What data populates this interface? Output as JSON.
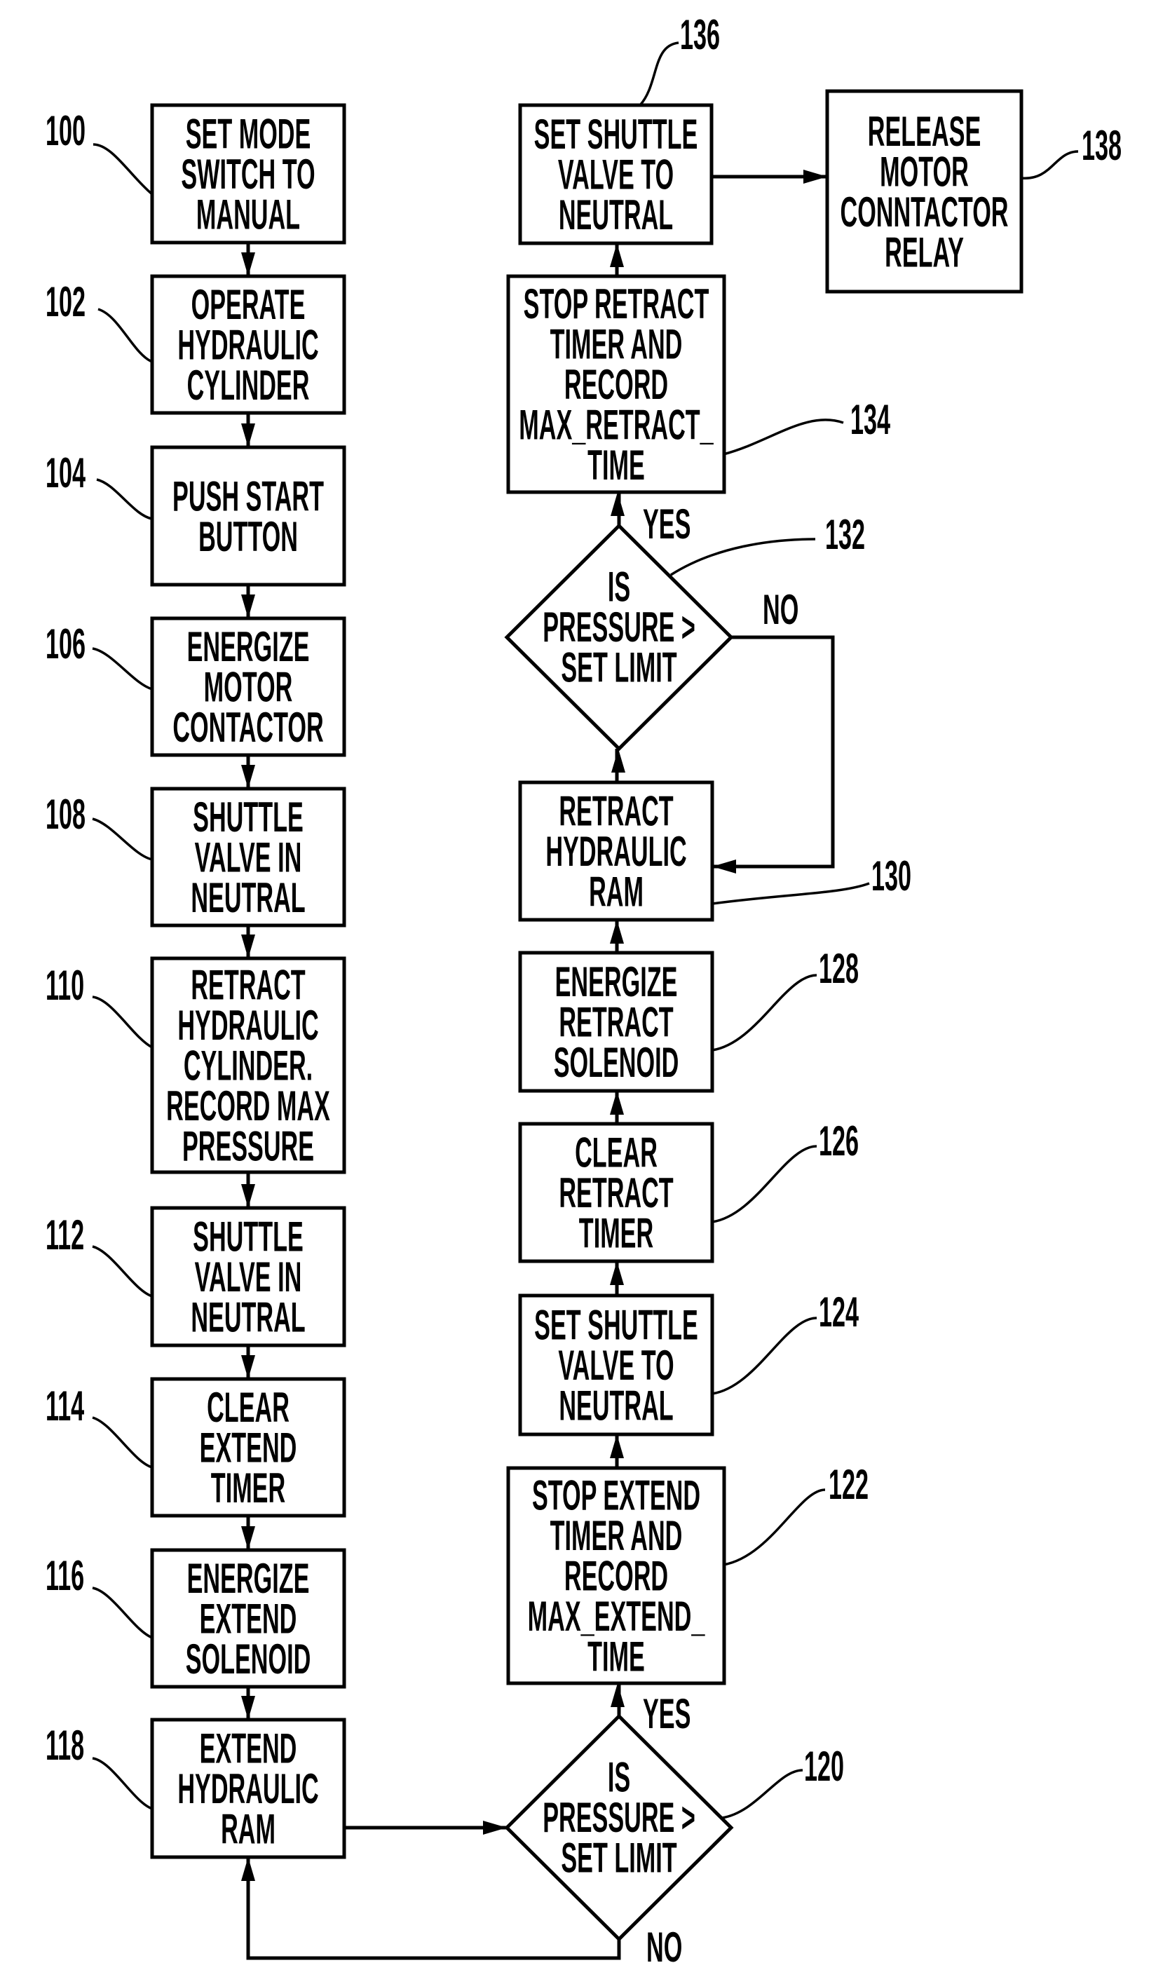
{
  "figure": {
    "steps": [
      {
        "id": "100",
        "shape": "process",
        "lines": [
          "SET MODE",
          "SWITCH TO",
          "MANUAL"
        ]
      },
      {
        "id": "102",
        "shape": "process",
        "lines": [
          "OPERATE",
          "HYDRAULIC",
          "CYLINDER"
        ]
      },
      {
        "id": "104",
        "shape": "process",
        "lines": [
          "PUSH START",
          "BUTTON"
        ]
      },
      {
        "id": "106",
        "shape": "process",
        "lines": [
          "ENERGIZE",
          "MOTOR",
          "CONTACTOR"
        ]
      },
      {
        "id": "108",
        "shape": "process",
        "lines": [
          "SHUTTLE",
          "VALVE IN",
          "NEUTRAL"
        ]
      },
      {
        "id": "110",
        "shape": "process",
        "lines": [
          "RETRACT",
          "HYDRAULIC",
          "CYLINDER.",
          "RECORD MAX",
          "PRESSURE"
        ]
      },
      {
        "id": "112",
        "shape": "process",
        "lines": [
          "SHUTTLE",
          "VALVE IN",
          "NEUTRAL"
        ]
      },
      {
        "id": "114",
        "shape": "process",
        "lines": [
          "CLEAR",
          "EXTEND",
          "TIMER"
        ]
      },
      {
        "id": "116",
        "shape": "process",
        "lines": [
          "ENERGIZE",
          "EXTEND",
          "SOLENOID"
        ]
      },
      {
        "id": "118",
        "shape": "process",
        "lines": [
          "EXTEND",
          "HYDRAULIC",
          "RAM"
        ]
      },
      {
        "id": "120",
        "shape": "decision",
        "lines": [
          "IS",
          "PRESSURE >",
          "SET LIMIT"
        ]
      },
      {
        "id": "122",
        "shape": "process",
        "lines": [
          "STOP EXTEND",
          "TIMER AND",
          "RECORD",
          "MAX_EXTEND_",
          "TIME"
        ]
      },
      {
        "id": "124",
        "shape": "process",
        "lines": [
          "SET SHUTTLE",
          "VALVE TO",
          "NEUTRAL"
        ]
      },
      {
        "id": "126",
        "shape": "process",
        "lines": [
          "CLEAR",
          "RETRACT",
          "TIMER"
        ]
      },
      {
        "id": "128",
        "shape": "process",
        "lines": [
          "ENERGIZE",
          "RETRACT",
          "SOLENOID"
        ]
      },
      {
        "id": "130",
        "shape": "process",
        "lines": [
          "RETRACT",
          "HYDRAULIC",
          "RAM"
        ]
      },
      {
        "id": "132",
        "shape": "decision",
        "lines": [
          "IS",
          "PRESSURE >",
          "SET LIMIT"
        ]
      },
      {
        "id": "134",
        "shape": "process",
        "lines": [
          "STOP RETRACT",
          "TIMER AND",
          "RECORD",
          "MAX_RETRACT_",
          "TIME"
        ]
      },
      {
        "id": "136",
        "shape": "process",
        "lines": [
          "SET SHUTTLE",
          "VALVE TO",
          "NEUTRAL"
        ]
      },
      {
        "id": "138",
        "shape": "process",
        "lines": [
          "RELEASE",
          "MOTOR",
          "CONNTACTOR",
          "RELAY"
        ]
      }
    ],
    "branch_labels": [
      {
        "decision": "132",
        "text": "YES"
      },
      {
        "decision": "132",
        "text": "NO"
      },
      {
        "decision": "120",
        "text": "YES"
      },
      {
        "decision": "120",
        "text": "NO"
      }
    ],
    "edges": [
      [
        "100",
        "102"
      ],
      [
        "102",
        "104"
      ],
      [
        "104",
        "106"
      ],
      [
        "106",
        "108"
      ],
      [
        "108",
        "110"
      ],
      [
        "110",
        "112"
      ],
      [
        "112",
        "114"
      ],
      [
        "114",
        "116"
      ],
      [
        "116",
        "118"
      ],
      [
        "118",
        "120"
      ],
      [
        "120",
        "122",
        "YES"
      ],
      [
        "120",
        "118",
        "NO"
      ],
      [
        "122",
        "124"
      ],
      [
        "124",
        "126"
      ],
      [
        "126",
        "128"
      ],
      [
        "128",
        "130"
      ],
      [
        "130",
        "132"
      ],
      [
        "132",
        "134",
        "YES"
      ],
      [
        "132",
        "130",
        "NO"
      ],
      [
        "134",
        "136"
      ],
      [
        "136",
        "138"
      ]
    ]
  }
}
